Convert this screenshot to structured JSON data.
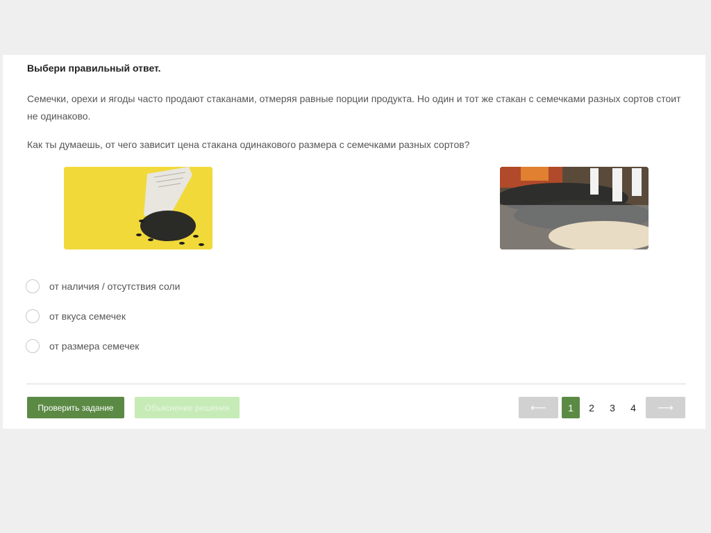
{
  "task": {
    "prompt": "Выбери правильный ответ.",
    "paragraph": "Семечки, орехи и ягоды часто продают стаканами, отмеряя равные порции продукта. Но один и тот же стакан с семечками разных сортов стоит не одинаково.",
    "question": "Как ты думаешь, от чего зависит цена стакана одинакового размера с семечками разных сортов?"
  },
  "options": [
    {
      "label": "от наличия / отсутствия соли"
    },
    {
      "label": "от вкуса семечек"
    },
    {
      "label": "от размера семечек"
    }
  ],
  "buttons": {
    "check": "Проверить задание",
    "explain": "Объяснение решения"
  },
  "pagination": {
    "prev": "⟵",
    "pages": [
      "1",
      "2",
      "3",
      "4"
    ],
    "current": "1",
    "next": "⟶"
  },
  "colors": {
    "accent": "#5b8a45",
    "accent_light": "#c6ebb7"
  }
}
